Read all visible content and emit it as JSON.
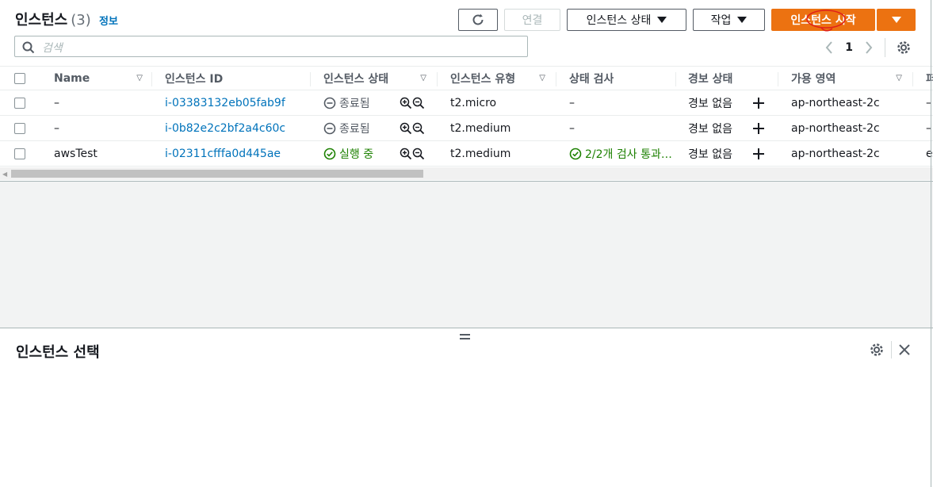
{
  "header": {
    "title": "인스턴스",
    "count": "(3)",
    "info": "정보"
  },
  "toolbar": {
    "connect": "연결",
    "instance_state": "인스턴스 상태",
    "actions": "작업",
    "launch": "인스턴스 시작"
  },
  "search": {
    "placeholder": "검색"
  },
  "pager": {
    "page": "1"
  },
  "table": {
    "headers": {
      "name": "Name",
      "instance_id": "인스턴스 ID",
      "state": "인스턴스 상태",
      "type": "인스턴스 유형",
      "status_check": "상태 검사",
      "alarm": "경보 상태",
      "az": "가용 영역",
      "next": "퍼"
    },
    "rows": [
      {
        "name": "–",
        "id": "i-03383132eb05fab9f",
        "state": "종료됨",
        "type": "t2.micro",
        "status": "–",
        "alarm": "경보 없음",
        "az": "ap-northeast-2c",
        "next": "–"
      },
      {
        "name": "–",
        "id": "i-0b82e2c2bf2a4c60c",
        "state": "종료됨",
        "type": "t2.medium",
        "status": "–",
        "alarm": "경보 없음",
        "az": "ap-northeast-2c",
        "next": "–"
      },
      {
        "name": "awsTest",
        "id": "i-02311cfffa0d445ae",
        "state": "실행 중",
        "type": "t2.medium",
        "status": "2/2개 검사 통과…",
        "alarm": "경보 없음",
        "az": "ap-northeast-2c",
        "next": "e"
      }
    ]
  },
  "detail": {
    "title": "인스턴스 선택"
  }
}
